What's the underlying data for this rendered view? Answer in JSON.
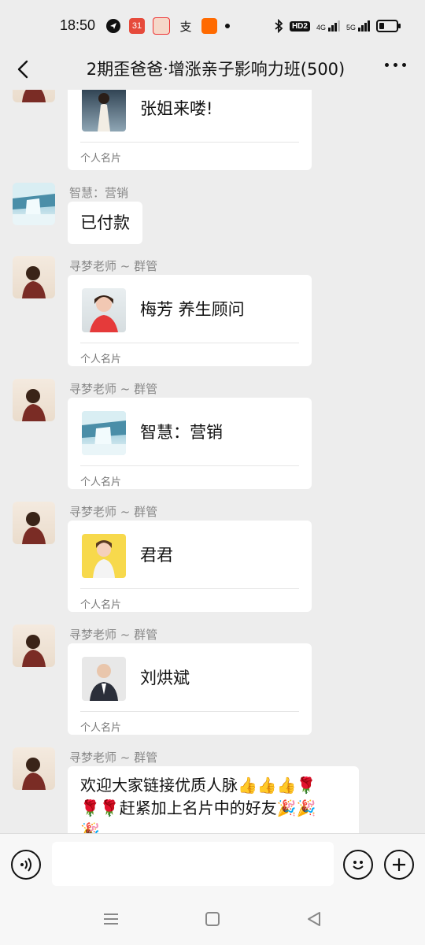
{
  "status_bar": {
    "time": "18:50",
    "app_icons": [
      "31",
      "支"
    ],
    "network_1": "4G",
    "network_2": "5G",
    "hd_label": "HD2",
    "icons": [
      "location-arrow-icon",
      "calendar-icon",
      "shopping-app-icon",
      "alipay-icon",
      "taobao-icon",
      "dot-icon",
      "bluetooth-icon",
      "hd-voice-icon",
      "signal-4g-icon",
      "signal-5g-icon",
      "battery-icon"
    ]
  },
  "header": {
    "title": "2期歪爸爸·增涨亲子影响力班(500)"
  },
  "messages": [
    {
      "type": "card",
      "sender": "",
      "name": "张姐来喽!",
      "card_type": "个人名片"
    },
    {
      "type": "text",
      "sender": "智慧：营销",
      "text": "已付款"
    },
    {
      "type": "card",
      "sender": "寻梦老师 ~ 群管",
      "name": "梅芳 养生顾问",
      "card_type": "个人名片"
    },
    {
      "type": "card",
      "sender": "寻梦老师 ~ 群管",
      "name": "智慧：营销",
      "card_type": "个人名片"
    },
    {
      "type": "card",
      "sender": "寻梦老师 ~ 群管",
      "name": "君君",
      "card_type": "个人名片"
    },
    {
      "type": "card",
      "sender": "寻梦老师 ~ 群管",
      "name": "刘烘斌",
      "card_type": "个人名片"
    },
    {
      "type": "text",
      "sender": "寻梦老师 ~ 群管",
      "line1": "欢迎大家链接优质人脉👍👍👍🌹",
      "line2": "🌹🌹赶紧加上名片中的好友🎉🎉",
      "line3": "🎉"
    }
  ],
  "input": {
    "value": "",
    "placeholder": ""
  },
  "colors": {
    "background": "#ededed",
    "bubble": "#ffffff",
    "sender_text": "#888888"
  }
}
